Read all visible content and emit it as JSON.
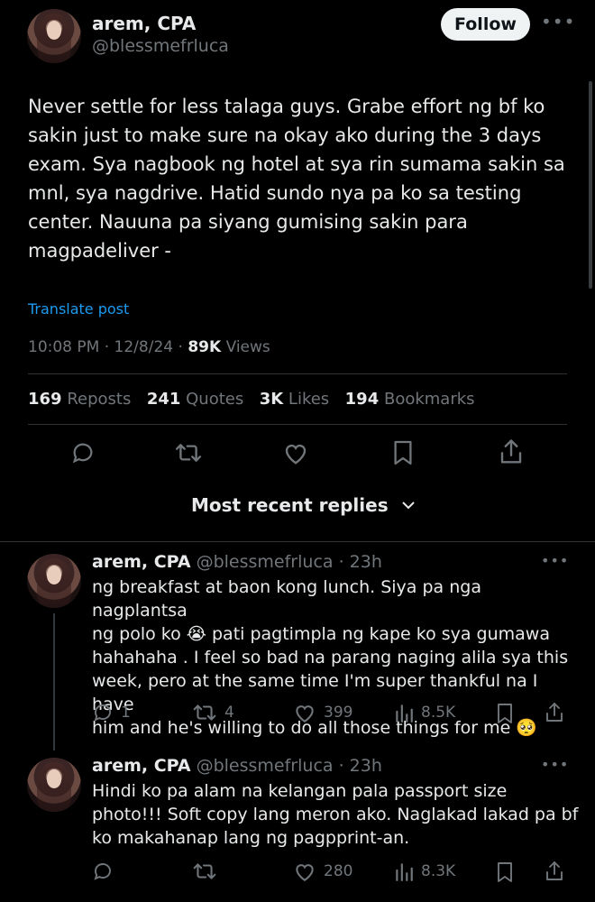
{
  "post": {
    "author_name": "arem, CPA",
    "author_handle": "@blessmefrluca",
    "follow_label": "Follow",
    "text": "Never settle for less talaga guys. Grabe effort ng bf ko\nsakin just to make sure na okay ako during the 3 days\nexam. Sya nagbook ng hotel at sya rin sumama sakin sa\nmnl, sya nagdrive. Hatid sundo nya pa ko sa testing\ncenter. Nauuna pa siyang gumising sakin para\nmagpadeliver -",
    "translate_label": "Translate post",
    "time": "10:08 PM",
    "date": "12/8/24",
    "views_count": "89K",
    "views_label": "Views",
    "reposts_count": "169",
    "reposts_label": "Reposts",
    "quotes_count": "241",
    "quotes_label": "Quotes",
    "likes_count": "3K",
    "likes_label": "Likes",
    "bookmarks_count": "194",
    "bookmarks_label": "Bookmarks"
  },
  "replies_sort": {
    "label": "Most recent replies"
  },
  "replies": [
    {
      "author_name": "arem, CPA",
      "author_handle": "@blessmefrluca",
      "time_ago": "23h",
      "text": "ng breakfast at baon kong lunch. Siya pa nga nagplantsa\nng polo ko 😭 pati pagtimpla ng kape ko sya gumawa\nhahahaha . I feel so bad na parang naging alila sya this\nweek, pero at the same time I'm super thankful na I have\nhim and he's willing to do all those things for me 🥺",
      "replies_count": "1",
      "reposts_count": "4",
      "likes_count": "399",
      "views_count": "8.5K"
    },
    {
      "author_name": "arem, CPA",
      "author_handle": "@blessmefrluca",
      "time_ago": "23h",
      "text": "Hindi ko pa alam na kelangan pala passport size\nphoto!!! Soft copy lang meron ako. Naglakad lakad pa bf\nko makahanap lang ng pagpprint-an.",
      "replies_count": "",
      "reposts_count": "",
      "likes_count": "280",
      "views_count": "8.3K"
    }
  ],
  "colors": {
    "background": "#000000",
    "text": "#e7e9ea",
    "muted": "#71767b",
    "link": "#1d9bf0",
    "divider": "#2f3336"
  },
  "icons": [
    "reply-icon",
    "repost-icon",
    "like-icon",
    "bookmark-icon",
    "share-icon",
    "views-icon",
    "more-icon",
    "chevron-down-icon"
  ]
}
